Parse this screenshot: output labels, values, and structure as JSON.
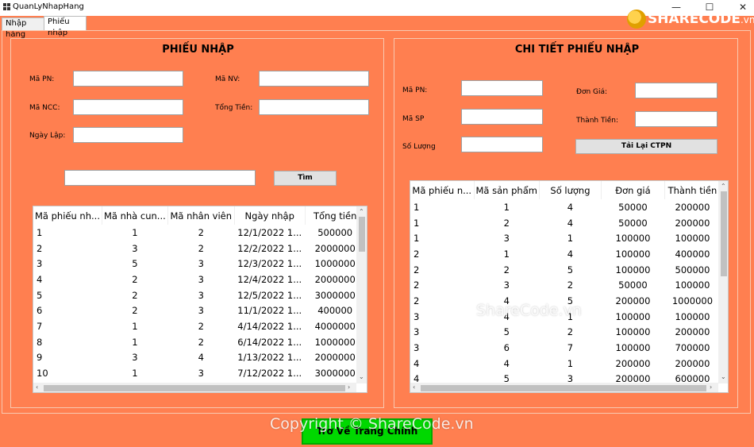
{
  "window": {
    "title": "QuanLyNhapHang",
    "minimize_glyph": "—",
    "maximize_glyph": "☐",
    "close_glyph": "✕",
    "logo_text": "SHARECODE",
    "logo_suffix": ".vn"
  },
  "tabs": [
    {
      "label": "Nhập hàng",
      "active": false
    },
    {
      "label": "Phiếu nhập",
      "active": true
    }
  ],
  "phieu_nhap": {
    "title": "PHIẾU NHẬP",
    "ma_pn_label": "Mã PN:",
    "ma_nv_label": "Mã NV:",
    "ma_ncc_label": "Mã NCC:",
    "tong_tien_label": "Tổng Tiền:",
    "ngay_lap_label": "Ngày Lập:",
    "search_button": "Tìm",
    "table": {
      "columns": [
        "Mã phiếu nh...",
        "Mã nhà cun...",
        "Mã nhân viên",
        "Ngày nhập",
        "Tổng tiền"
      ],
      "rows": [
        [
          "1",
          "1",
          "2",
          "12/1/2022 1...",
          "500000"
        ],
        [
          "2",
          "3",
          "2",
          "12/2/2022 1...",
          "2000000"
        ],
        [
          "3",
          "5",
          "3",
          "12/3/2022 1...",
          "1000000"
        ],
        [
          "4",
          "2",
          "3",
          "12/4/2022 1...",
          "2000000"
        ],
        [
          "5",
          "2",
          "3",
          "12/5/2022 1...",
          "3000000"
        ],
        [
          "6",
          "2",
          "3",
          "11/1/2022 1...",
          "400000"
        ],
        [
          "7",
          "1",
          "2",
          "4/14/2022 1...",
          "4000000"
        ],
        [
          "8",
          "1",
          "2",
          "6/14/2022 1...",
          "1000000"
        ],
        [
          "9",
          "3",
          "4",
          "1/13/2022 1...",
          "2000000"
        ],
        [
          "10",
          "1",
          "3",
          "7/12/2022 1...",
          "3000000"
        ]
      ]
    }
  },
  "chi_tiet": {
    "title": "CHI TIẾT PHIẾU NHẬP",
    "ma_pn_label": "Mã PN:",
    "don_gia_label": "Đơn Giá:",
    "ma_sp_label": "Mã SP",
    "thanh_tien_label": "Thành Tiền:",
    "so_luong_label": "Số Lượng",
    "reload_button": "Tải Lại CTPN",
    "table": {
      "columns": [
        "Mã phiếu n...",
        "Mã sản phẩm",
        "Số lượng",
        "Đơn giá",
        "Thành tiền"
      ],
      "rows": [
        [
          "1",
          "1",
          "4",
          "50000",
          "200000"
        ],
        [
          "1",
          "2",
          "4",
          "50000",
          "200000"
        ],
        [
          "1",
          "3",
          "1",
          "100000",
          "100000"
        ],
        [
          "2",
          "1",
          "4",
          "100000",
          "400000"
        ],
        [
          "2",
          "2",
          "5",
          "100000",
          "500000"
        ],
        [
          "2",
          "3",
          "2",
          "50000",
          "100000"
        ],
        [
          "2",
          "4",
          "5",
          "200000",
          "1000000"
        ],
        [
          "3",
          "4",
          "1",
          "100000",
          "100000"
        ],
        [
          "3",
          "5",
          "2",
          "100000",
          "200000"
        ],
        [
          "3",
          "6",
          "7",
          "100000",
          "700000"
        ],
        [
          "4",
          "4",
          "1",
          "200000",
          "200000"
        ],
        [
          "4",
          "5",
          "3",
          "200000",
          "600000"
        ]
      ]
    }
  },
  "footer": {
    "back_button": "Trở Về Trang Chính"
  },
  "watermarks": {
    "center": "ShareCode.vn",
    "bottom": "Copyright © ShareCode.vn"
  }
}
